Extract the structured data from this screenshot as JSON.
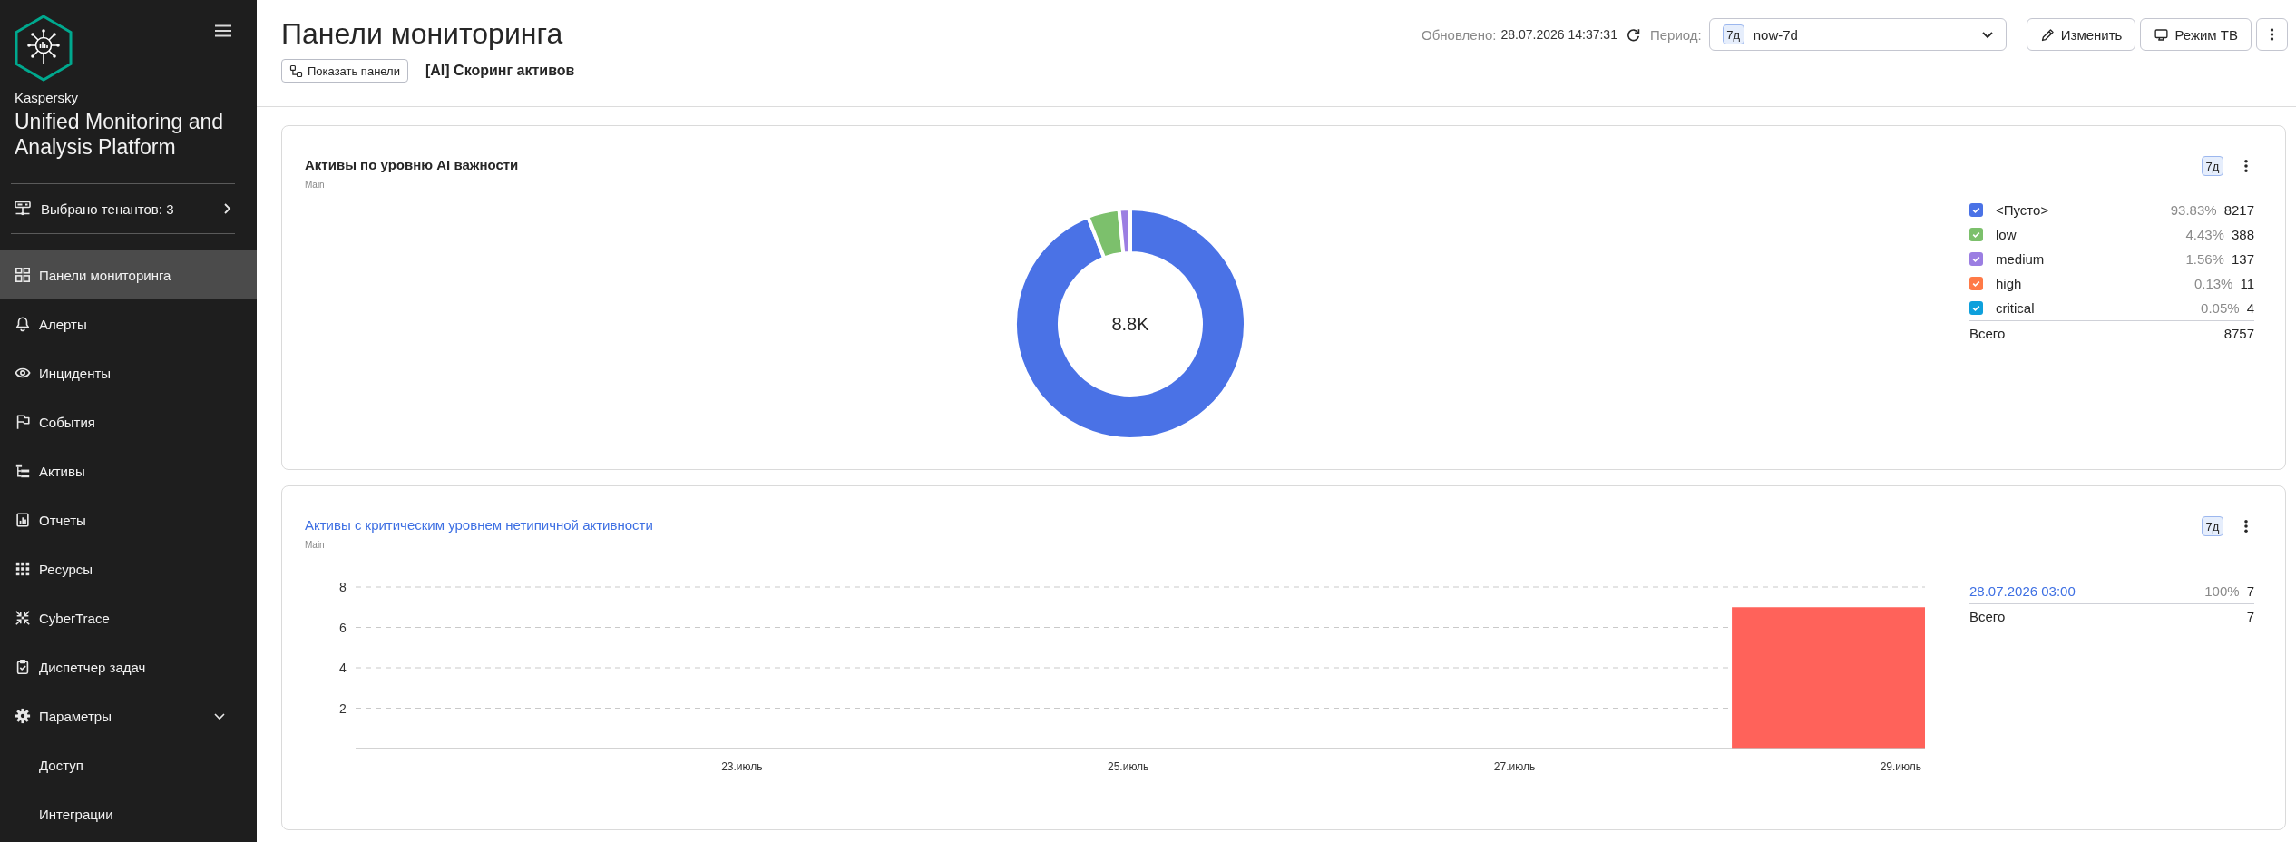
{
  "sidebar": {
    "vendor": "Kaspersky",
    "product": "Unified Monitoring and Analysis Platform",
    "tenants": "Выбрано тенантов: 3",
    "nav": [
      {
        "label": "Панели мониторинга",
        "selected": true
      },
      {
        "label": "Алерты",
        "selected": false
      },
      {
        "label": "Инциденты",
        "selected": false
      },
      {
        "label": "События",
        "selected": false
      },
      {
        "label": "Активы",
        "selected": false
      },
      {
        "label": "Отчеты",
        "selected": false
      },
      {
        "label": "Ресурсы",
        "selected": false
      },
      {
        "label": "CyberTrace",
        "selected": false
      },
      {
        "label": "Диспетчер задач",
        "selected": false
      },
      {
        "label": "Параметры",
        "selected": false,
        "expanded": true,
        "children": [
          {
            "label": "Доступ",
            "selected": false
          },
          {
            "label": "Интеграции",
            "selected": false
          }
        ]
      }
    ]
  },
  "header": {
    "title": "Панели мониторинга",
    "show_panels": "Показать панели",
    "dashboard": "[AI] Скоринг активов",
    "updated_label": "Обновлено:",
    "updated_value": "28.07.2026 14:37:31",
    "period_label": "Период:",
    "period": {
      "badge": "7д",
      "value": "now-7d"
    },
    "buttons": [
      "Изменить",
      "Режим ТВ"
    ]
  },
  "widgets": [
    {
      "title": "Активы по уровню AI важности",
      "title_link": false,
      "subtitle": "Main",
      "period_badge": "7д",
      "center_label": "8.8K",
      "chart_data": {
        "type": "donut",
        "values": [
          93.83,
          4.43,
          1.56,
          null,
          null
        ]
      },
      "legend": {
        "label_link": false,
        "items": [
          {
            "label": "<Пусто>",
            "percent": "93.83%",
            "count": "8217",
            "color": "#4a72e6",
            "checked": true
          },
          {
            "label": "low",
            "percent": "4.43%",
            "count": "388",
            "color": "#7cc06c",
            "checked": true
          },
          {
            "label": "medium",
            "percent": "1.56%",
            "count": "137",
            "color": "#9b7ee2",
            "checked": true
          },
          {
            "label": "high",
            "percent": "0.13%",
            "count": "11",
            "color": "#ff7a47",
            "checked": true
          },
          {
            "label": "critical",
            "percent": "0.05%",
            "count": "4",
            "color": "#0ea0dc",
            "checked": true
          }
        ],
        "total": {
          "label": "Всего",
          "value": "8757"
        }
      }
    },
    {
      "title": "Активы с критическим уровнем нетипичной активности",
      "title_link": true,
      "subtitle": "Main",
      "period_badge": "7д",
      "chart_data": {
        "type": "bar",
        "grid": true,
        "x": [
          28.625
        ],
        "series": [
          {
            "color": "#ff625a",
            "values": [
              7
            ]
          }
        ],
        "xlim": [
          21,
          29.125
        ],
        "ylim": [
          0,
          8
        ],
        "xticks": [
          {
            "value": 23,
            "label": "23.июль"
          },
          {
            "value": 25,
            "label": "25.июль"
          },
          {
            "value": 27,
            "label": "27.июль"
          },
          {
            "value": 29,
            "label": "29.июль"
          }
        ],
        "yticks": [
          2,
          4,
          6,
          8
        ]
      },
      "legend": {
        "label_link": true,
        "items": [
          {
            "label": "28.07.2026 03:00",
            "percent": "100%",
            "count": "7"
          }
        ],
        "total": {
          "label": "Всего",
          "value": "7"
        }
      }
    }
  ]
}
